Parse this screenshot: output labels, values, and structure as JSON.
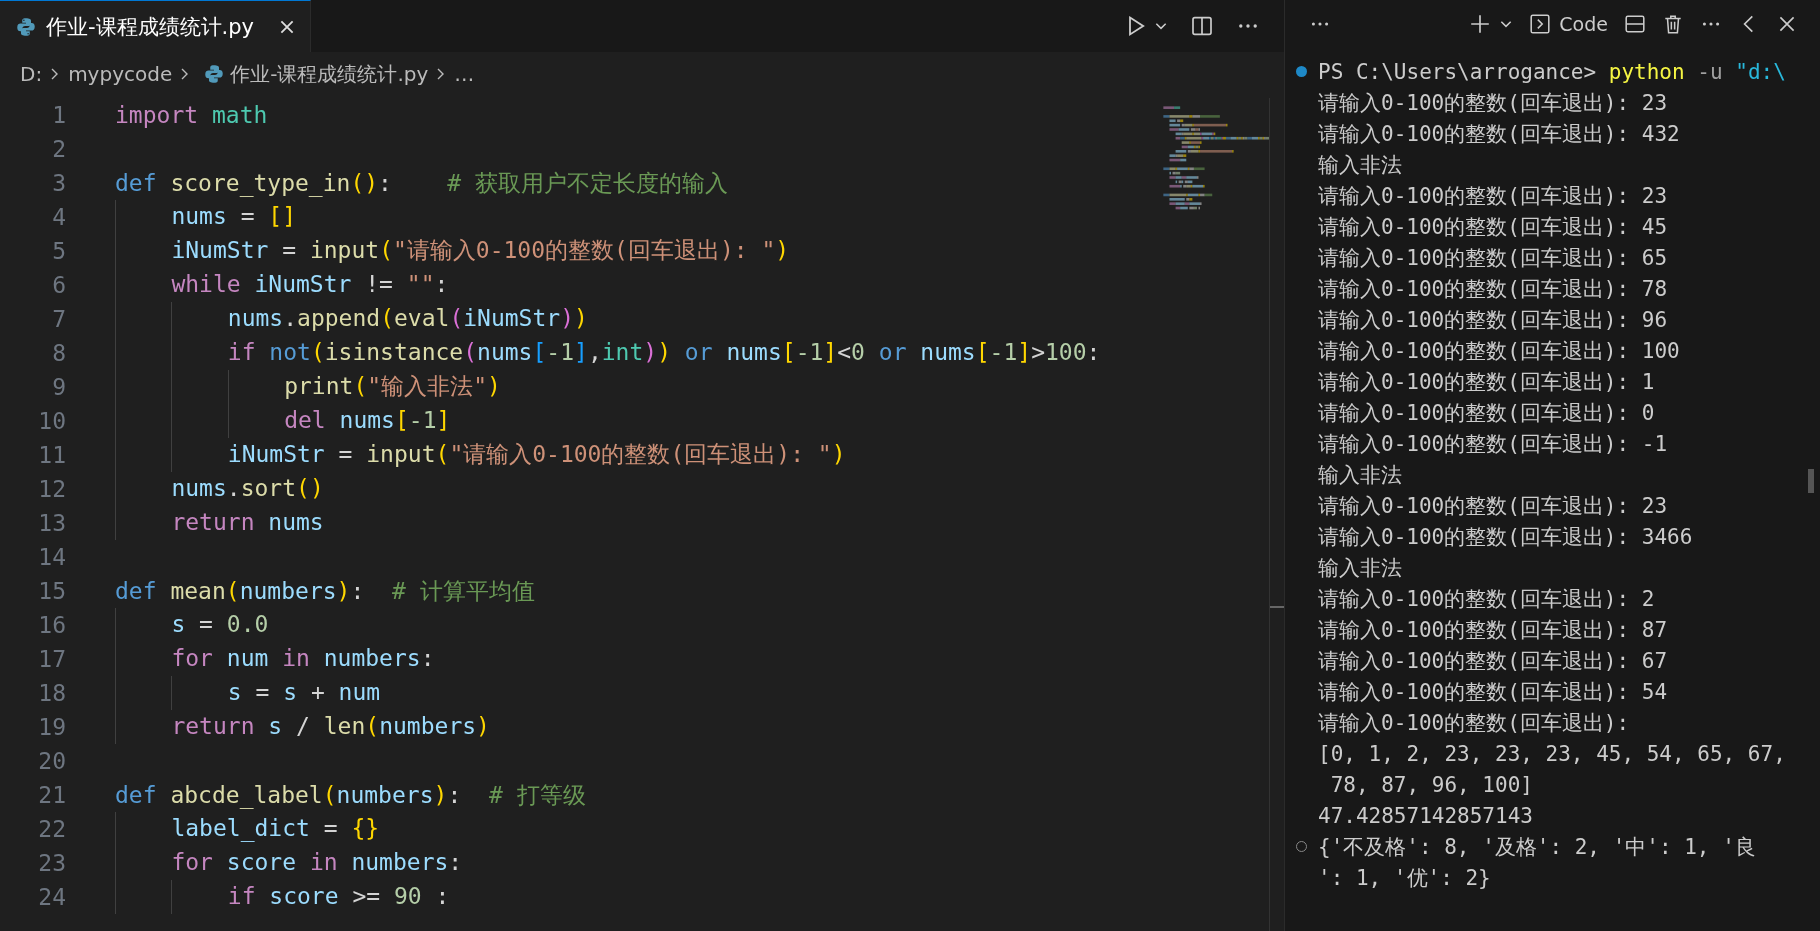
{
  "editor": {
    "tab": {
      "title": "作业-课程成绩统计.py",
      "selected": true
    },
    "breadcrumb": [
      {
        "label": "D:",
        "kind": "folder"
      },
      {
        "label": "mypycode",
        "kind": "folder"
      },
      {
        "label": "作业-课程成绩统计.py",
        "kind": "file"
      },
      {
        "label": "…",
        "kind": "more"
      }
    ],
    "lines": [
      {
        "number": "1",
        "tokens": [
          {
            "text": "import ",
            "kind": "kw"
          },
          {
            "text": "math",
            "kind": "mod"
          }
        ]
      },
      {
        "number": "2"
      },
      {
        "number": "3",
        "tokens": [
          {
            "text": "def ",
            "kind": "def"
          },
          {
            "text": "score_type_in",
            "kind": "fn"
          },
          {
            "text": "()",
            "kind": "b1"
          },
          {
            "text": ":    ",
            "kind": "p"
          },
          {
            "text": "# 获取用户不定长度的输入",
            "kind": "cmt"
          }
        ]
      },
      {
        "number": "4",
        "tokens": [
          {
            "text": "    nums",
            "kind": "var"
          },
          {
            "text": " = ",
            "kind": "p"
          },
          {
            "text": "[]",
            "kind": "b1"
          }
        ]
      },
      {
        "number": "5",
        "tokens": [
          {
            "text": "    iNumStr",
            "kind": "var"
          },
          {
            "text": " = ",
            "kind": "p"
          },
          {
            "text": "input",
            "kind": "fn"
          },
          {
            "text": "(",
            "kind": "b1"
          },
          {
            "text": "\"请输入0-100的整数(回车退出): \"",
            "kind": "str"
          },
          {
            "text": ")",
            "kind": "b1"
          }
        ]
      },
      {
        "number": "6",
        "tokens": [
          {
            "text": "    while ",
            "kind": "kw"
          },
          {
            "text": "iNumStr",
            "kind": "var"
          },
          {
            "text": " != ",
            "kind": "p"
          },
          {
            "text": "\"\"",
            "kind": "str"
          },
          {
            "text": ":",
            "kind": "p"
          }
        ]
      },
      {
        "number": "7",
        "tokens": [
          {
            "text": "        nums",
            "kind": "var"
          },
          {
            "text": ".",
            "kind": "p"
          },
          {
            "text": "append",
            "kind": "fn"
          },
          {
            "text": "(",
            "kind": "b1"
          },
          {
            "text": "eval",
            "kind": "fn"
          },
          {
            "text": "(",
            "kind": "b2"
          },
          {
            "text": "iNumStr",
            "kind": "var"
          },
          {
            "text": ")",
            "kind": "b2"
          },
          {
            "text": ")",
            "kind": "b1"
          }
        ]
      },
      {
        "number": "8",
        "tokens": [
          {
            "text": "        if ",
            "kind": "kw"
          },
          {
            "text": "not",
            "kind": "def"
          },
          {
            "text": "(",
            "kind": "b1"
          },
          {
            "text": "isinstance",
            "kind": "fn"
          },
          {
            "text": "(",
            "kind": "b2"
          },
          {
            "text": "nums",
            "kind": "var"
          },
          {
            "text": "[",
            "kind": "b3"
          },
          {
            "text": "-1",
            "kind": "num"
          },
          {
            "text": "]",
            "kind": "b3"
          },
          {
            "text": ",",
            "kind": "p"
          },
          {
            "text": "int",
            "kind": "mod"
          },
          {
            "text": ")",
            "kind": "b2"
          },
          {
            "text": ") ",
            "kind": "b1"
          },
          {
            "text": "or ",
            "kind": "def"
          },
          {
            "text": "nums",
            "kind": "var"
          },
          {
            "text": "[",
            "kind": "b1"
          },
          {
            "text": "-1",
            "kind": "num"
          },
          {
            "text": "]",
            "kind": "b1"
          },
          {
            "text": "<",
            "kind": "p"
          },
          {
            "text": "0 ",
            "kind": "num"
          },
          {
            "text": "or ",
            "kind": "def"
          },
          {
            "text": "nums",
            "kind": "var"
          },
          {
            "text": "[",
            "kind": "b1"
          },
          {
            "text": "-1",
            "kind": "num"
          },
          {
            "text": "]",
            "kind": "b1"
          },
          {
            "text": ">",
            "kind": "p"
          },
          {
            "text": "100",
            "kind": "num"
          },
          {
            "text": ":",
            "kind": "p"
          }
        ]
      },
      {
        "number": "9",
        "tokens": [
          {
            "text": "            print",
            "kind": "fn"
          },
          {
            "text": "(",
            "kind": "b1"
          },
          {
            "text": "\"输入非法\"",
            "kind": "str"
          },
          {
            "text": ")",
            "kind": "b1"
          }
        ]
      },
      {
        "number": "10",
        "tokens": [
          {
            "text": "            del ",
            "kind": "kw"
          },
          {
            "text": "nums",
            "kind": "var"
          },
          {
            "text": "[",
            "kind": "b1"
          },
          {
            "text": "-1",
            "kind": "num"
          },
          {
            "text": "]",
            "kind": "b1"
          }
        ]
      },
      {
        "number": "11",
        "tokens": [
          {
            "text": "        iNumStr",
            "kind": "var"
          },
          {
            "text": " = ",
            "kind": "p"
          },
          {
            "text": "input",
            "kind": "fn"
          },
          {
            "text": "(",
            "kind": "b1"
          },
          {
            "text": "\"请输入0-100的整数(回车退出): \"",
            "kind": "str"
          },
          {
            "text": ")",
            "kind": "b1"
          }
        ]
      },
      {
        "number": "12",
        "tokens": [
          {
            "text": "    nums",
            "kind": "var"
          },
          {
            "text": ".",
            "kind": "p"
          },
          {
            "text": "sort",
            "kind": "fn"
          },
          {
            "text": "()",
            "kind": "b1"
          }
        ]
      },
      {
        "number": "13",
        "tokens": [
          {
            "text": "    return ",
            "kind": "kw"
          },
          {
            "text": "nums",
            "kind": "var"
          }
        ]
      },
      {
        "number": "14"
      },
      {
        "number": "15",
        "tokens": [
          {
            "text": "def ",
            "kind": "def"
          },
          {
            "text": "mean",
            "kind": "fn"
          },
          {
            "text": "(",
            "kind": "b1"
          },
          {
            "text": "numbers",
            "kind": "var"
          },
          {
            "text": ")",
            "kind": "b1"
          },
          {
            "text": ":  ",
            "kind": "p"
          },
          {
            "text": "# 计算平均值",
            "kind": "cmt"
          }
        ]
      },
      {
        "number": "16",
        "tokens": [
          {
            "text": "    s",
            "kind": "var"
          },
          {
            "text": " = ",
            "kind": "p"
          },
          {
            "text": "0.0",
            "kind": "num"
          }
        ]
      },
      {
        "number": "17",
        "tokens": [
          {
            "text": "    for ",
            "kind": "kw"
          },
          {
            "text": "num ",
            "kind": "var"
          },
          {
            "text": "in ",
            "kind": "kw"
          },
          {
            "text": "numbers",
            "kind": "var"
          },
          {
            "text": ":",
            "kind": "p"
          }
        ]
      },
      {
        "number": "18",
        "tokens": [
          {
            "text": "        s",
            "kind": "var"
          },
          {
            "text": " = ",
            "kind": "p"
          },
          {
            "text": "s",
            "kind": "var"
          },
          {
            "text": " + ",
            "kind": "p"
          },
          {
            "text": "num",
            "kind": "var"
          }
        ]
      },
      {
        "number": "19",
        "tokens": [
          {
            "text": "    return ",
            "kind": "kw"
          },
          {
            "text": "s",
            "kind": "var"
          },
          {
            "text": " / ",
            "kind": "p"
          },
          {
            "text": "len",
            "kind": "fn"
          },
          {
            "text": "(",
            "kind": "b1"
          },
          {
            "text": "numbers",
            "kind": "var"
          },
          {
            "text": ")",
            "kind": "b1"
          }
        ]
      },
      {
        "number": "20"
      },
      {
        "number": "21",
        "tokens": [
          {
            "text": "def ",
            "kind": "def"
          },
          {
            "text": "abcde_label",
            "kind": "fn"
          },
          {
            "text": "(",
            "kind": "b1"
          },
          {
            "text": "numbers",
            "kind": "var"
          },
          {
            "text": ")",
            "kind": "b1"
          },
          {
            "text": ":  ",
            "kind": "p"
          },
          {
            "text": "# 打等级",
            "kind": "cmt"
          }
        ]
      },
      {
        "number": "22",
        "tokens": [
          {
            "text": "    label_dict",
            "kind": "var"
          },
          {
            "text": " = ",
            "kind": "p"
          },
          {
            "text": "{}",
            "kind": "b1"
          }
        ]
      },
      {
        "number": "23",
        "tokens": [
          {
            "text": "    for ",
            "kind": "kw"
          },
          {
            "text": "score ",
            "kind": "var"
          },
          {
            "text": "in ",
            "kind": "kw"
          },
          {
            "text": "numbers",
            "kind": "var"
          },
          {
            "text": ":",
            "kind": "p"
          }
        ]
      },
      {
        "number": "24",
        "tokens": [
          {
            "text": "        if ",
            "kind": "kw"
          },
          {
            "text": "score",
            "kind": "var"
          },
          {
            "text": " >= ",
            "kind": "p"
          },
          {
            "text": "90",
            "kind": "num"
          },
          {
            "text": " :",
            "kind": "p"
          }
        ]
      }
    ]
  },
  "terminal": {
    "profile_label": "Code",
    "lines": [
      {
        "segments": [
          {
            "text": "PS C:\\Users\\arrogance> ",
            "kind": "plain"
          },
          {
            "text": "python",
            "kind": "cmd"
          },
          {
            "text": " -u ",
            "kind": "arg"
          },
          {
            "text": "\"d:\\",
            "kind": "str"
          }
        ],
        "finished": true
      },
      {
        "text": "请输入0-100的整数(回车退出): 23"
      },
      {
        "text": "请输入0-100的整数(回车退出): 432"
      },
      {
        "text": "输入非法"
      },
      {
        "text": "请输入0-100的整数(回车退出): 23"
      },
      {
        "text": "请输入0-100的整数(回车退出): 45"
      },
      {
        "text": "请输入0-100的整数(回车退出): 65"
      },
      {
        "text": "请输入0-100的整数(回车退出): 78"
      },
      {
        "text": "请输入0-100的整数(回车退出): 96"
      },
      {
        "text": "请输入0-100的整数(回车退出): 100"
      },
      {
        "text": "请输入0-100的整数(回车退出): 1"
      },
      {
        "text": "请输入0-100的整数(回车退出): 0"
      },
      {
        "text": "请输入0-100的整数(回车退出): -1"
      },
      {
        "text": "输入非法"
      },
      {
        "text": "请输入0-100的整数(回车退出): 23"
      },
      {
        "text": "请输入0-100的整数(回车退出): 3466"
      },
      {
        "text": "输入非法"
      },
      {
        "text": "请输入0-100的整数(回车退出): 2"
      },
      {
        "text": "请输入0-100的整数(回车退出): 87"
      },
      {
        "text": "请输入0-100的整数(回车退出): 67"
      },
      {
        "text": "请输入0-100的整数(回车退出): 54"
      },
      {
        "text": "请输入0-100的整数(回车退出):"
      },
      {
        "text": "[0, 1, 2, 23, 23, 23, 45, 54, 65, 67,"
      },
      {
        "text": " 78, 87, 96, 100]"
      },
      {
        "text": "47.42857142857143"
      },
      {
        "text": "{'不及格': 8, '及格': 2, '中': 1, '良",
        "finished": false
      },
      {
        "text": "': 1, '优': 2}"
      }
    ]
  }
}
